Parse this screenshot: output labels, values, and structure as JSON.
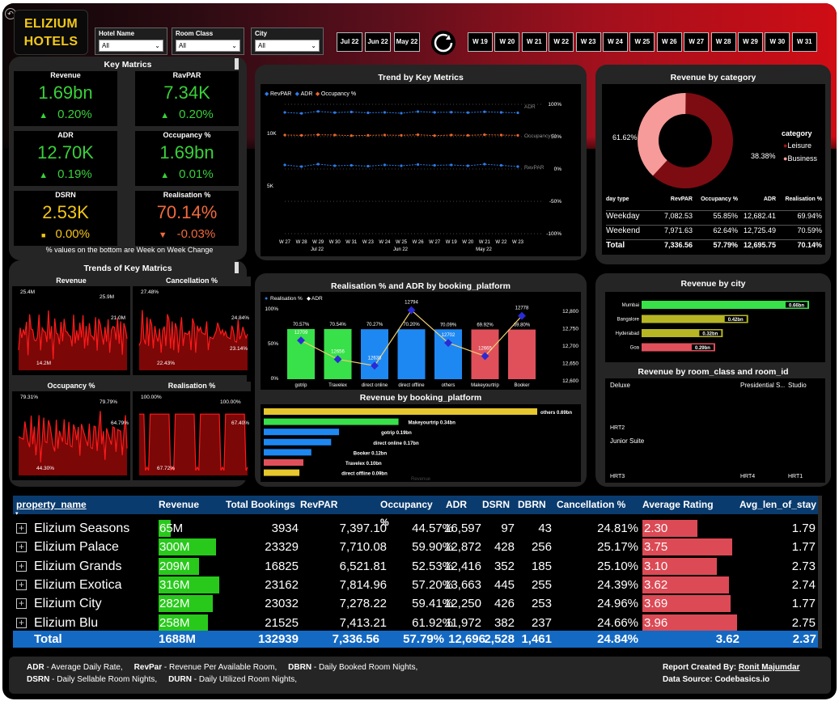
{
  "header": {
    "logo_line1": "ELIZIUM",
    "logo_line2": "HOTELS",
    "slicers": [
      {
        "label": "Hotel Name",
        "value": "All"
      },
      {
        "label": "Room Class",
        "value": "All"
      },
      {
        "label": "City",
        "value": "All"
      }
    ],
    "months": [
      "Jul 22",
      "Jun 22",
      "May 22"
    ],
    "weeks": [
      "W 19",
      "W 20",
      "W 21",
      "W 22",
      "W 23",
      "W 24",
      "W 25",
      "W 26",
      "W 27",
      "W 28",
      "W 29",
      "W 30",
      "W 31"
    ]
  },
  "key_metrics": {
    "title": "Key Matrics",
    "tiles": [
      {
        "label": "Revenue",
        "value": "1.69bn",
        "change": "0.20%",
        "dir": "up",
        "color": "#39d03a"
      },
      {
        "label": "RavPAR",
        "value": "7.34K",
        "change": "0.20%",
        "dir": "up",
        "color": "#39d03a"
      },
      {
        "label": "ADR",
        "value": "12.70K",
        "change": "0.19%",
        "dir": "up",
        "color": "#39d03a"
      },
      {
        "label": "Occupancy %",
        "value": "1.69bn",
        "change": "0.01%",
        "dir": "up",
        "color": "#39d03a"
      },
      {
        "label": "DSRN",
        "value": "2.53K",
        "change": "0.00%",
        "dir": "flat",
        "color": "#f3c518"
      },
      {
        "label": "Realisation %",
        "value": "70.14%",
        "change": "-0.03%",
        "dir": "down",
        "color": "#f26a3d"
      }
    ],
    "note": "% values on the bottom are Week on Week Change"
  },
  "trends": {
    "title": "Trends of Key Matrics",
    "minis": [
      {
        "label": "Revenue",
        "max_label": "25.4M",
        "max2": "25.9M",
        "mid": "21.0M",
        "min_label": "14.2M"
      },
      {
        "label": "Cancellation %",
        "max_label": "27.48%",
        "mid": "24.84%",
        "v3": "23.14%",
        "min_label": "22.43%"
      },
      {
        "label": "Occupancy %",
        "max_label": "79.31%",
        "max2": "79.79%",
        "mid": "64.79%",
        "min_label": "44.30%"
      },
      {
        "label": "Realisation %",
        "max_label": "100.00%",
        "max2": "100.00%",
        "mid": "67.40%",
        "min_label": "67.72%"
      }
    ]
  },
  "trend_chart": {
    "title": "Trend by Key Metrics",
    "legend": [
      "RevPAR",
      "ADR",
      "Occupancy %"
    ],
    "left_ticks": [
      "10K",
      "5K"
    ],
    "right_ticks": [
      "100%",
      "50%",
      "0%",
      "-50%",
      "-100%"
    ],
    "end_labels": [
      "ADR",
      "Occupancy %",
      "RevPAR"
    ],
    "x_weeks": [
      "W 27",
      "W 28",
      "W 29",
      "W 30",
      "W 31",
      "W 23",
      "W 24",
      "W 25",
      "W 26",
      "W 27",
      "W 19",
      "W 20",
      "W 21",
      "W 22",
      "W 23"
    ],
    "x_months": [
      "Jul 22",
      "Jun 22",
      "May 22"
    ],
    "chart_data": {
      "type": "line",
      "series": [
        {
          "name": "ADR",
          "values": [
            12700,
            12650,
            12750,
            12690,
            12720,
            12680,
            12700,
            12660,
            12740,
            12700,
            12710,
            12690,
            12730,
            12700,
            12680
          ]
        },
        {
          "name": "Occupancy %",
          "values": [
            58,
            57,
            59,
            58,
            56,
            57,
            58,
            57,
            59,
            56,
            58,
            57,
            59,
            58,
            57
          ]
        },
        {
          "name": "RevPAR",
          "values": [
            7400,
            7200,
            7500,
            7300,
            7350,
            7250,
            7400,
            7300,
            7450,
            7350,
            7400,
            7300,
            7500,
            7350,
            7200
          ]
        }
      ]
    }
  },
  "rev_category": {
    "title": "Revenue by category",
    "legend_title": "category",
    "labels": [
      "Leisure",
      "Business"
    ],
    "pcts": [
      "61.62%",
      "38.38%"
    ],
    "chart_data": {
      "type": "pie",
      "categories": [
        "Leisure",
        "Business"
      ],
      "values": [
        61.62,
        38.38
      ]
    },
    "cols": [
      "day type",
      "RevPAR",
      "Occupancy %",
      "ADR",
      "Realisation %"
    ],
    "rows": [
      [
        "Weekday",
        "7,082.53",
        "55.85%",
        "12,682.41",
        "69.94%"
      ],
      [
        "Weekend",
        "7,971.63",
        "62.64%",
        "12,725.49",
        "70.59%"
      ],
      [
        "Total",
        "7,336.56",
        "57.79%",
        "12,695.75",
        "70.14%"
      ]
    ]
  },
  "realisation": {
    "title": "Realisation % and ADR by booking_platform",
    "legend": [
      "Realisation %",
      "ADR"
    ],
    "left_ticks": [
      "100%",
      "50%",
      "0%"
    ],
    "right_ticks": [
      "12,800",
      "12,750",
      "12,700",
      "12,650",
      "12,600"
    ],
    "chart_data": {
      "type": "bar",
      "categories": [
        "gotrip",
        "Travelex",
        "direct online",
        "direct offline",
        "others",
        "Makeyourtrip",
        "Booker"
      ],
      "series": [
        {
          "name": "Realisation %",
          "values": [
            70.57,
            70.54,
            70.27,
            70.2,
            70.09,
            69.92,
            69.8
          ]
        },
        {
          "name": "ADR",
          "values": [
            12709,
            12656,
            12638,
            12794,
            12702,
            12665,
            12778
          ]
        }
      ]
    },
    "pct_labels": [
      "70.57%",
      "70.54%",
      "70.27%",
      "70.20%",
      "70.09%",
      "69.92%",
      "69.80%"
    ],
    "adr_labels": [
      "12709",
      "12656",
      "12638",
      "12794",
      "12702",
      "12665",
      "12778"
    ]
  },
  "rev_platform": {
    "title": "Revenue by booking_platform",
    "chart_data": {
      "type": "bar",
      "categories": [
        "others",
        "Makeyourtrip",
        "gotrip",
        "direct online",
        "Booker",
        "Travelex",
        "direct offline"
      ],
      "values": [
        0.69,
        0.34,
        0.19,
        0.17,
        0.12,
        0.1,
        0.09
      ]
    },
    "labels": [
      "others 0.69bn",
      "Makeyourtrip 0.34bn",
      "gotrip 0.19bn",
      "direct online 0.17bn",
      "Booker 0.12bn",
      "Travelex 0.10bn",
      "direct offline 0.09bn"
    ],
    "colors": [
      "#e6c72d",
      "#38e04a",
      "#1e88f2",
      "#1e88f2",
      "#1e88f2",
      "#e0505b",
      "#e6c72d"
    ],
    "axis": "Revenue"
  },
  "rev_city": {
    "title": "Revenue by city",
    "chart_data": {
      "type": "bar",
      "categories": [
        "Mumbai",
        "Bangalore",
        "Hyderabad",
        "Goa"
      ],
      "values": [
        0.66,
        0.42,
        0.32,
        0.29
      ]
    },
    "labels": [
      "0.66bn",
      "0.42bn",
      "0.32bn",
      "0.29bn"
    ],
    "colors": [
      "#38e04a",
      "#b6b624",
      "#b6b624",
      "#e0505b"
    ]
  },
  "treemap": {
    "title": "Revenue by room_class and room_id",
    "cells": [
      {
        "label": "Deluxe",
        "id": "HRT2",
        "color": "#1b3bd6"
      },
      {
        "label": "Junior Suite",
        "id": "HRT3",
        "color": "#13279a"
      },
      {
        "label": "Presidential S...",
        "id": "HRT4",
        "color": "#e0703d"
      },
      {
        "label": "Studio",
        "id": "HRT1",
        "color": "#7b0f8a"
      }
    ]
  },
  "table": {
    "headers": [
      "property_name",
      "Revenue",
      "Total Bookings",
      "RevPAR",
      "Occupancy %",
      "ADR",
      "DSRN",
      "DBRN",
      "Cancellation %",
      "Average Rating",
      "Avg_len_of_stay"
    ],
    "rows": [
      [
        "Elizium Seasons",
        "65M",
        "3934",
        "7,397.10",
        "44.57%",
        "16,597",
        "97",
        "43",
        "24.81%",
        "2.30",
        "1.79"
      ],
      [
        "Elizium Palace",
        "300M",
        "23329",
        "7,710.08",
        "59.90%",
        "12,872",
        "428",
        "256",
        "25.17%",
        "3.75",
        "1.77"
      ],
      [
        "Elizium Grands",
        "209M",
        "16825",
        "6,521.81",
        "52.53%",
        "12,416",
        "352",
        "185",
        "25.10%",
        "3.10",
        "2.73"
      ],
      [
        "Elizium Exotica",
        "316M",
        "23162",
        "7,814.96",
        "57.20%",
        "13,663",
        "445",
        "255",
        "24.39%",
        "3.62",
        "2.74"
      ],
      [
        "Elizium City",
        "282M",
        "23032",
        "7,278.22",
        "59.41%",
        "12,250",
        "426",
        "253",
        "24.96%",
        "3.69",
        "1.77"
      ],
      [
        "Elizium Blu",
        "258M",
        "21525",
        "7,413.21",
        "61.92%",
        "11,972",
        "382",
        "237",
        "24.66%",
        "3.96",
        "2.75"
      ]
    ],
    "revenue_values": [
      65,
      300,
      209,
      316,
      282,
      258
    ],
    "rating_values": [
      2.3,
      3.75,
      3.1,
      3.62,
      3.69,
      3.96
    ],
    "total": [
      "Total",
      "1688M",
      "132939",
      "7,336.56",
      "57.79%",
      "12,696",
      "2,528",
      "1,461",
      "24.84%",
      "3.62",
      "2.37"
    ]
  },
  "footer": {
    "l1a": "ADR",
    "l1b": " - Average Daily Rate,",
    "l1c": "RevPar",
    "l1d": " - Revenue Per Available Room,",
    "l1e": "DBRN",
    "l1f": " - Daily Booked Room Nights,",
    "l2a": "DSRN",
    "l2b": " - Daily Sellable Room Nights,",
    "l2c": "DURN",
    "l2d": " - Daily Utilized Room Nights,",
    "r1a": "Report Created By: ",
    "r1b": "Ronit Majumdar",
    "r2": "Data Source: Codebasics.io"
  }
}
